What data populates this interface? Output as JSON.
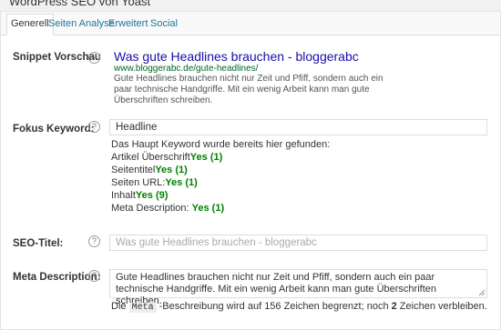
{
  "plugin_title": "WordPress SEO von Yoast",
  "tabs": [
    {
      "label": "Generell"
    },
    {
      "label": "Seiten Analyse"
    },
    {
      "label": "Erweitert"
    },
    {
      "label": "Social"
    }
  ],
  "snippet": {
    "label": "Snippet Vorschau",
    "title": "Was gute Headlines brauchen - bloggerabc",
    "url": "www.bloggerabc.de/gute-headlines/",
    "description": "Gute Headlines brauchen nicht nur Zeit und Pfiff, sondern auch ein paar technische Handgriffe. Mit ein wenig Arbeit kann man gute Überschriften schreiben."
  },
  "focus_keyword": {
    "label": "Fokus Keyword:",
    "value": "Headline",
    "found_intro": "Das Haupt Keyword wurde bereits hier gefunden:",
    "checks": [
      {
        "name": "Artikel Überschrift",
        "result": "Yes (1)"
      },
      {
        "name": "Seitentitel",
        "result": "Yes (1)"
      },
      {
        "name": "Seiten URL:",
        "result": "Yes (1)"
      },
      {
        "name": "Inhalt",
        "result": "Yes (9)"
      },
      {
        "name": "Meta Description: ",
        "result": "Yes (1)"
      }
    ]
  },
  "seo_title": {
    "label": "SEO-Titel:",
    "placeholder": "Was gute Headlines brauchen - bloggerabc"
  },
  "meta_description": {
    "label": "Meta Description:",
    "value": "Gute Headlines brauchen nicht nur Zeit und Pfiff, sondern auch ein paar technische Handgriffe. Mit ein wenig Arbeit kann man gute Überschriften schreiben.",
    "counter_prefix": "Die ",
    "counter_code": "Meta",
    "counter_mid": " -Beschreibung wird auf 156 Zeichen begrenzt; noch ",
    "counter_num": "2",
    "counter_suffix": " Zeichen verbleiben."
  },
  "help_glyph": "?"
}
